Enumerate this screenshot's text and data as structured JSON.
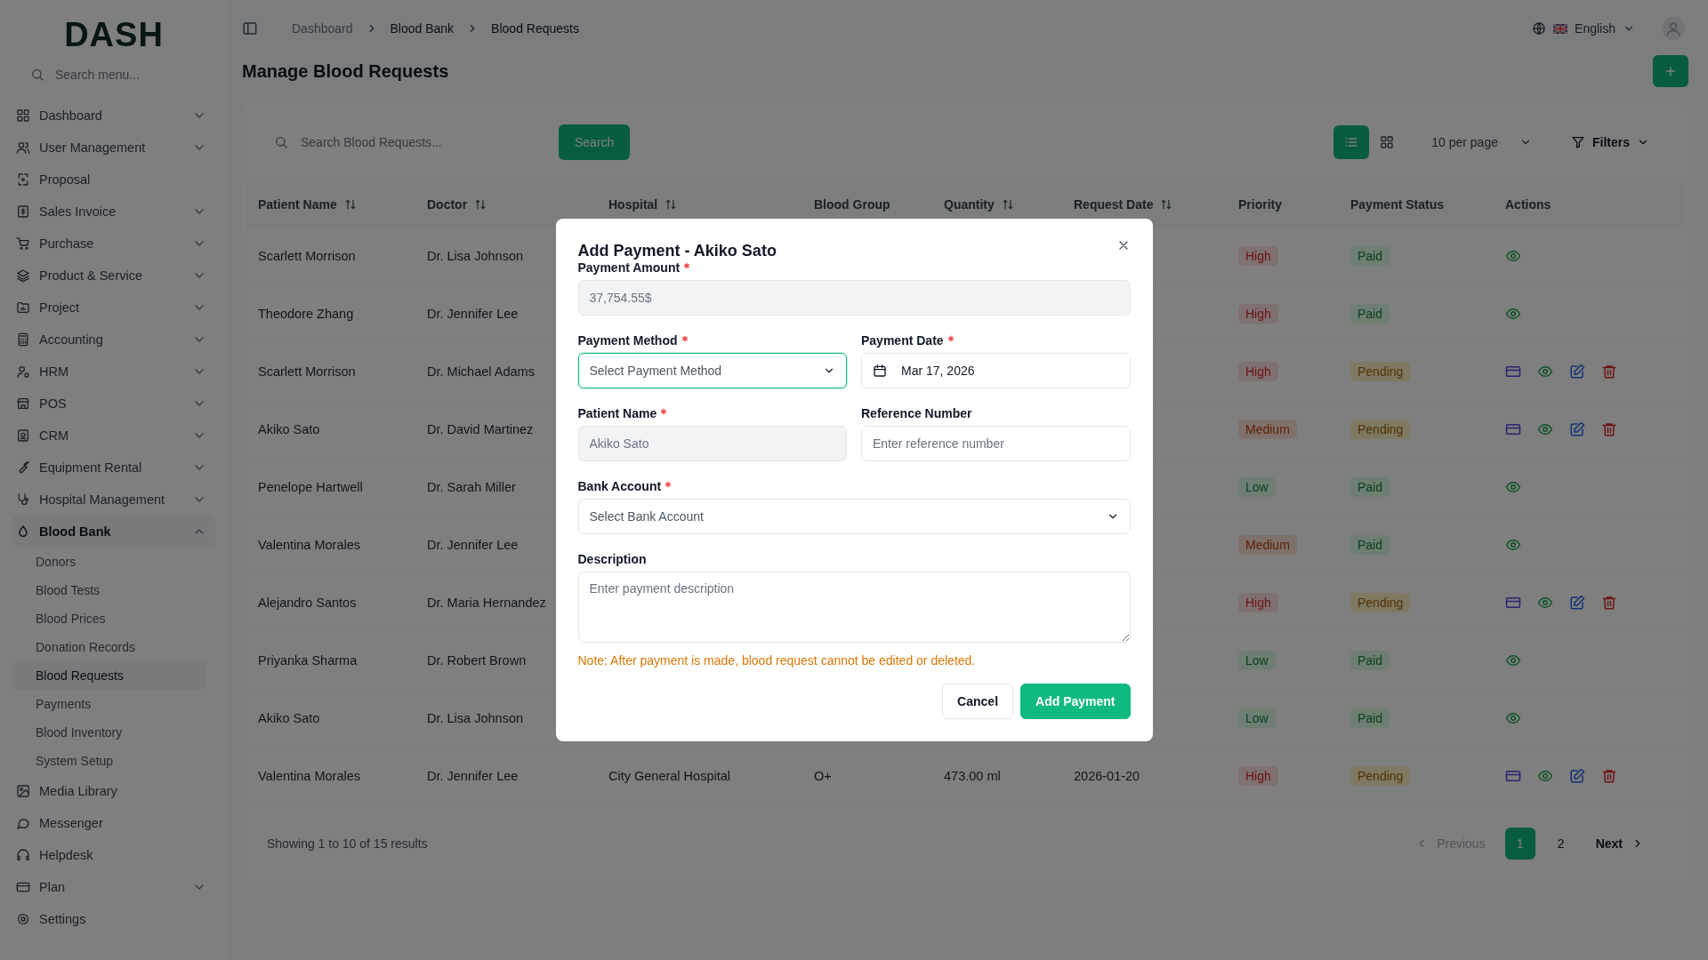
{
  "sidebar": {
    "logo": "DASH",
    "search_placeholder": "Search menu...",
    "items": [
      {
        "label": "Dashboard",
        "kind": "group",
        "expanded": false,
        "selected": false
      },
      {
        "label": "User Management",
        "kind": "group",
        "expanded": false,
        "selected": false
      },
      {
        "label": "Proposal",
        "kind": "link",
        "selected": false
      },
      {
        "label": "Sales Invoice",
        "kind": "group",
        "expanded": false,
        "selected": false
      },
      {
        "label": "Purchase",
        "kind": "group",
        "expanded": false,
        "selected": false
      },
      {
        "label": "Product & Service",
        "kind": "group",
        "expanded": false,
        "selected": false
      },
      {
        "label": "Project",
        "kind": "group",
        "expanded": false,
        "selected": false
      },
      {
        "label": "Accounting",
        "kind": "group",
        "expanded": false,
        "selected": false
      },
      {
        "label": "HRM",
        "kind": "group",
        "expanded": false,
        "selected": false
      },
      {
        "label": "POS",
        "kind": "group",
        "expanded": false,
        "selected": false
      },
      {
        "label": "CRM",
        "kind": "group",
        "expanded": false,
        "selected": false
      },
      {
        "label": "Equipment Rental",
        "kind": "group",
        "expanded": false,
        "selected": false
      },
      {
        "label": "Hospital Management",
        "kind": "group",
        "expanded": false,
        "selected": false
      },
      {
        "label": "Blood Bank",
        "kind": "group",
        "expanded": true,
        "selected": true,
        "children": [
          {
            "label": "Donors",
            "selected": false
          },
          {
            "label": "Blood Tests",
            "selected": false
          },
          {
            "label": "Blood Prices",
            "selected": false
          },
          {
            "label": "Donation Records",
            "selected": false
          },
          {
            "label": "Blood Requests",
            "selected": true
          },
          {
            "label": "Payments",
            "selected": false
          },
          {
            "label": "Blood Inventory",
            "selected": false
          },
          {
            "label": "System Setup",
            "selected": false
          }
        ]
      },
      {
        "label": "Media Library",
        "kind": "link",
        "selected": false
      },
      {
        "label": "Messenger",
        "kind": "link",
        "selected": false
      },
      {
        "label": "Helpdesk",
        "kind": "link",
        "selected": false
      },
      {
        "label": "Plan",
        "kind": "group",
        "expanded": false,
        "selected": false
      },
      {
        "label": "Settings",
        "kind": "link",
        "selected": false
      }
    ]
  },
  "breadcrumbs": [
    "Dashboard",
    "Blood Bank",
    "Blood Requests"
  ],
  "language": "English",
  "page_title": "Manage Blood Requests",
  "toolbar": {
    "search_placeholder": "Search Blood Requests...",
    "search_button": "Search",
    "view_toggles": [
      {
        "kind": "list",
        "selected": true
      },
      {
        "kind": "grid",
        "selected": false
      }
    ],
    "per_page": "10 per page",
    "filters": "Filters"
  },
  "table": {
    "columns": [
      {
        "label": "Patient Name",
        "sortable": true
      },
      {
        "label": "Doctor",
        "sortable": true
      },
      {
        "label": "Hospital",
        "sortable": true
      },
      {
        "label": "Blood Group",
        "sortable": false
      },
      {
        "label": "Quantity",
        "sortable": true
      },
      {
        "label": "Request Date",
        "sortable": true
      },
      {
        "label": "Priority",
        "sortable": false
      },
      {
        "label": "Payment Status",
        "sortable": false
      },
      {
        "label": "Actions",
        "sortable": false
      }
    ],
    "rows": [
      {
        "patient": "Scarlett Morrison",
        "doctor": "Dr. Lisa Johnson",
        "priority": {
          "text": "High",
          "kind": "high"
        },
        "status": {
          "text": "Paid",
          "kind": "paid"
        }
      },
      {
        "patient": "Theodore Zhang",
        "doctor": "Dr. Jennifer Lee",
        "priority": {
          "text": "High",
          "kind": "high"
        },
        "status": {
          "text": "Paid",
          "kind": "paid"
        }
      },
      {
        "patient": "Scarlett Morrison",
        "doctor": "Dr. Michael Adams",
        "priority": {
          "text": "High",
          "kind": "high"
        },
        "status": {
          "text": "Pending",
          "kind": "pending"
        }
      },
      {
        "patient": "Akiko Sato",
        "doctor": "Dr. David Martinez",
        "priority": {
          "text": "Medium",
          "kind": "medium"
        },
        "status": {
          "text": "Pending",
          "kind": "pending"
        }
      },
      {
        "patient": "Penelope Hartwell",
        "doctor": "Dr. Sarah Miller",
        "priority": {
          "text": "Low",
          "kind": "low"
        },
        "status": {
          "text": "Paid",
          "kind": "paid"
        }
      },
      {
        "patient": "Valentina Morales",
        "doctor": "Dr. Jennifer Lee",
        "priority": {
          "text": "Medium",
          "kind": "medium"
        },
        "status": {
          "text": "Paid",
          "kind": "paid"
        }
      },
      {
        "patient": "Alejandro Santos",
        "doctor": "Dr. Maria Hernandez",
        "priority": {
          "text": "High",
          "kind": "high"
        },
        "status": {
          "text": "Pending",
          "kind": "pending"
        }
      },
      {
        "patient": "Priyanka Sharma",
        "doctor": "Dr. Robert Brown",
        "priority": {
          "text": "Low",
          "kind": "low"
        },
        "status": {
          "text": "Paid",
          "kind": "paid"
        }
      },
      {
        "patient": "Akiko Sato",
        "doctor": "Dr. Lisa Johnson",
        "priority": {
          "text": "Low",
          "kind": "low"
        },
        "status": {
          "text": "Paid",
          "kind": "paid"
        }
      },
      {
        "patient": "Valentina Morales",
        "doctor": "Dr. Jennifer Lee",
        "hospital": "City General Hospital",
        "blood_group": "O+",
        "quantity": "473.00 ml",
        "request_date": "2026-01-20",
        "priority": {
          "text": "High",
          "kind": "high"
        },
        "status": {
          "text": "Pending",
          "kind": "pending"
        }
      }
    ]
  },
  "pagination": {
    "summary": "Showing 1 to 10 of 15 results",
    "previous": {
      "label": "Previous",
      "disabled": true
    },
    "pages": [
      {
        "label": "1",
        "selected": true
      },
      {
        "label": "2",
        "selected": false
      }
    ],
    "next": {
      "label": "Next",
      "disabled": false
    }
  },
  "modal": {
    "title": "Add Payment - Akiko Sato",
    "rows": [
      [
        {
          "label": "Payment Amount",
          "required": true,
          "kind": "text",
          "value": "37,754.55$",
          "disabled": true,
          "focused": false
        }
      ],
      [
        {
          "label": "Payment Method",
          "required": true,
          "kind": "select",
          "placeholder": "Select Payment Method",
          "disabled": false,
          "focused": true
        },
        {
          "label": "Payment Date",
          "required": true,
          "kind": "date",
          "value": "Mar 17, 2026",
          "disabled": false,
          "focused": false
        }
      ],
      [
        {
          "label": "Patient Name",
          "required": true,
          "kind": "text",
          "value": "Akiko Sato",
          "disabled": true,
          "focused": false
        },
        {
          "label": "Reference Number",
          "required": false,
          "kind": "text",
          "placeholder": "Enter reference number",
          "disabled": false,
          "focused": false
        }
      ],
      [
        {
          "label": "Bank Account",
          "required": true,
          "kind": "select",
          "placeholder": "Select Bank Account",
          "disabled": false,
          "focused": false
        }
      ],
      [
        {
          "label": "Description",
          "required": false,
          "kind": "textarea",
          "placeholder": "Enter payment description",
          "disabled": false,
          "focused": false
        }
      ]
    ],
    "note": "Note: After payment is made, blood request cannot be edited or deleted.",
    "buttons": [
      {
        "label": "Cancel",
        "kind": "secondary"
      },
      {
        "label": "Add Payment",
        "kind": "primary"
      }
    ]
  }
}
